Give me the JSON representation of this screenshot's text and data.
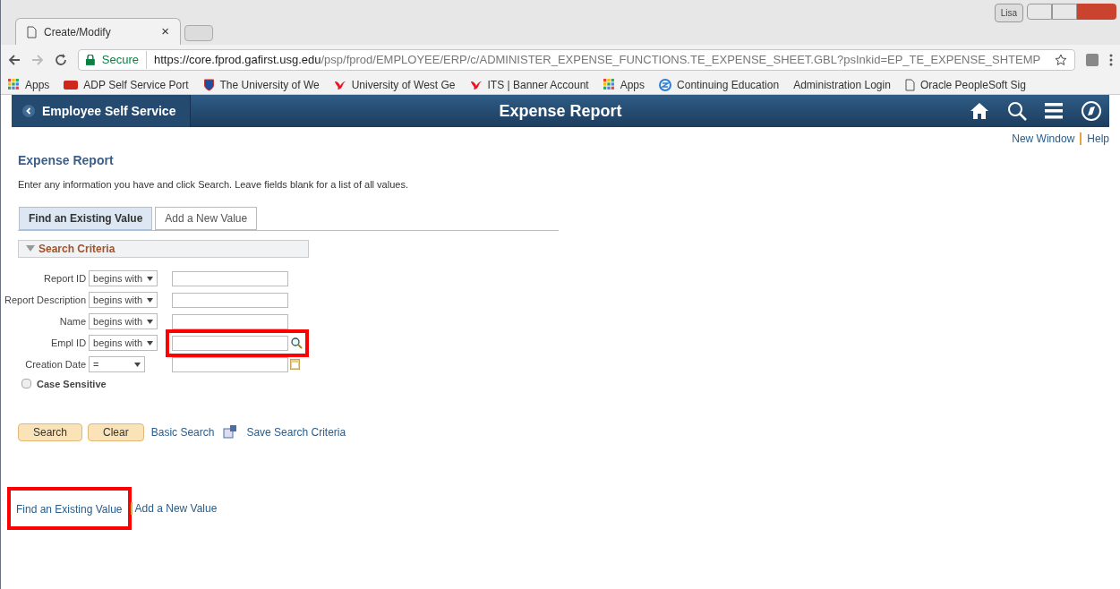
{
  "browser": {
    "user": "Lisa",
    "tab": {
      "title": "Create/Modify",
      "close": "×"
    },
    "security": "Secure",
    "url_host": "https://core.fprod.gafirst.usg.edu",
    "url_path": "/psp/fprod/EMPLOYEE/ERP/c/ADMINISTER_EXPENSE_FUNCTIONS.TE_EXPENSE_SHEET.GBL?psInkid=EP_TE_EXPENSE_SHTEMP",
    "bookmarks": [
      {
        "kind": "apps",
        "label": "Apps"
      },
      {
        "kind": "adp",
        "label": "ADP Self Service Port"
      },
      {
        "kind": "shield",
        "label": "The University of We"
      },
      {
        "kind": "flame",
        "label": "University of West Ge"
      },
      {
        "kind": "flame",
        "label": "ITS | Banner Account"
      },
      {
        "kind": "apps",
        "label": "Apps"
      },
      {
        "kind": "circle",
        "label": "Continuing Education"
      },
      {
        "kind": "none",
        "label": "Administration Login"
      },
      {
        "kind": "page",
        "label": "Oracle PeopleSoft Sig"
      }
    ]
  },
  "header": {
    "back": "Employee Self Service",
    "title": "Expense Report"
  },
  "top_links": [
    "New Window",
    "Help"
  ],
  "page": {
    "title": "Expense Report",
    "instructions": "Enter any information you have and click Search. Leave fields blank for a list of all values.",
    "tabs": [
      {
        "label": "Find an Existing Value",
        "selected": true
      },
      {
        "label": "Add a New Value",
        "selected": false
      }
    ],
    "section": {
      "title": "Search Criteria",
      "expanded": true
    },
    "fields": [
      {
        "label": "Report ID",
        "operator": "begins with",
        "kind": "text",
        "highlighted": false
      },
      {
        "label": "Report Description",
        "operator": "begins with",
        "kind": "text",
        "highlighted": false
      },
      {
        "label": "Name",
        "operator": "begins with",
        "kind": "text",
        "highlighted": false
      },
      {
        "label": "Empl ID",
        "operator": "begins with",
        "kind": "lookup",
        "highlighted": true
      },
      {
        "label": "Creation Date",
        "operator": "=",
        "kind": "date",
        "highlighted": false
      }
    ],
    "case_sensitive": {
      "label": "Case Sensitive",
      "checked": false
    },
    "buttons": [
      "Search",
      "Clear"
    ],
    "basic_search": "Basic Search",
    "save_criteria": "Save Search Criteria",
    "bottom_links": [
      {
        "label": "Find an Existing Value",
        "highlighted": true
      },
      {
        "label": "Add a New Value",
        "highlighted": false
      }
    ]
  }
}
